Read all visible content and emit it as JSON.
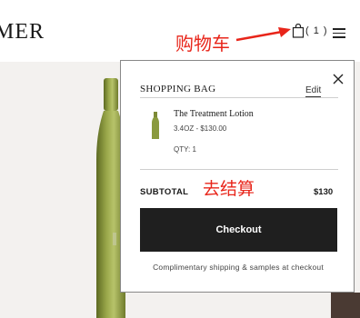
{
  "header": {
    "logo": "MER",
    "bag_count": "( 1 )"
  },
  "annotations": {
    "cart_label": "购物车",
    "checkout_label": "去结算",
    "color": "#e8251a"
  },
  "cart": {
    "title": "SHOPPING BAG",
    "edit_label": "Edit",
    "item": {
      "name": "The Treatment Lotion",
      "price": "3.4OZ - $130.00",
      "qty": "QTY: 1"
    },
    "subtotal_label": "SUBTOTAL",
    "subtotal_value": "$130",
    "checkout_label": "Checkout",
    "shipping_note": "Complimentary shipping & samples at checkout"
  },
  "icons": {
    "bag": "shopping-bag-icon",
    "menu": "hamburger-menu-icon",
    "close": "close-icon"
  }
}
